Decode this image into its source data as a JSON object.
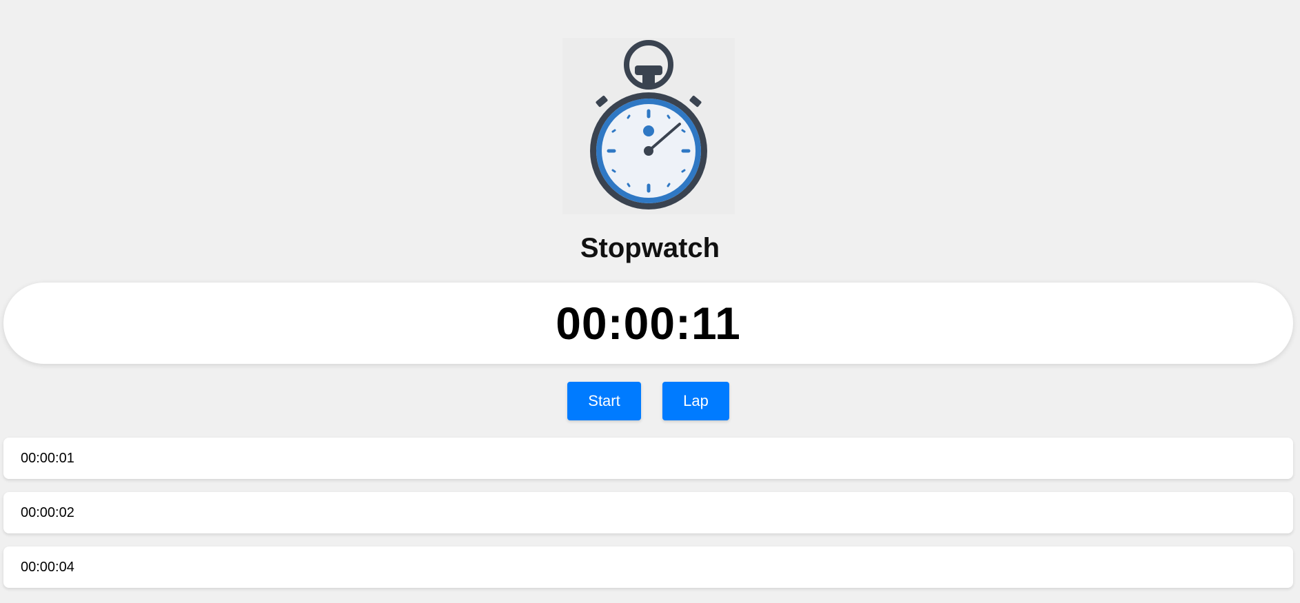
{
  "app": {
    "title": "Stopwatch",
    "icon": "stopwatch-icon"
  },
  "display": {
    "time": "00:00:11"
  },
  "controls": {
    "start_label": "Start",
    "lap_label": "Lap"
  },
  "laps": [
    {
      "time": "00:00:01"
    },
    {
      "time": "00:00:02"
    },
    {
      "time": "00:00:04"
    }
  ],
  "colors": {
    "accent": "#007bff",
    "icon_dark": "#3a4350",
    "icon_blue": "#2f78c4",
    "background": "#f0f0f0"
  }
}
